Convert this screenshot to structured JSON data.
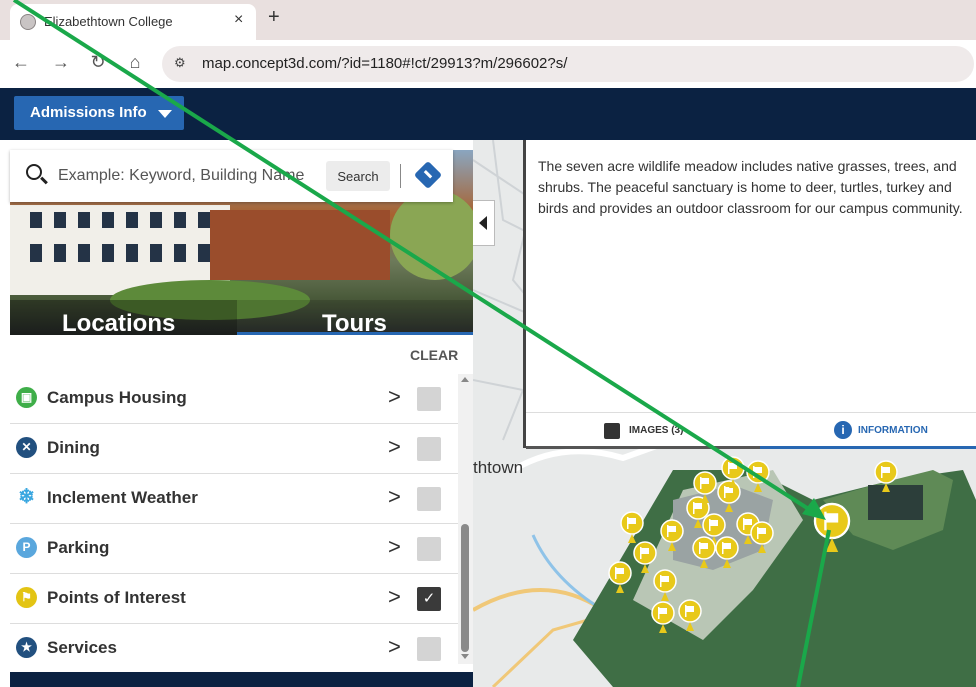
{
  "browser": {
    "tab_title": "Elizabethtown College",
    "close_glyph": "×",
    "newtab_glyph": "+",
    "url": "map.concept3d.com/?id=1180#!ct/29913?m/296602?s/",
    "back_glyph": "←",
    "forward_glyph": "→",
    "reload_glyph": "↻",
    "home_glyph": "⌂",
    "site_info_glyph": "⚙"
  },
  "header": {
    "admissions_label": "Admissions Info"
  },
  "search": {
    "placeholder": "Example: Keyword, Building Name",
    "button_label": "Search"
  },
  "hero": {
    "locations_label": "Locations",
    "tours_label": "Tours"
  },
  "filters": {
    "clear_label": "CLEAR",
    "categories": [
      {
        "label": "Campus Housing",
        "icon": "housing-icon",
        "color": "#3fae49",
        "glyph": "▣",
        "checked": false
      },
      {
        "label": "Dining",
        "icon": "dining-icon",
        "color": "#22507f",
        "glyph": "✕",
        "checked": false
      },
      {
        "label": "Inclement Weather",
        "icon": "snowflake-icon",
        "color": "#3aa7e0",
        "glyph": "❄",
        "checked": false
      },
      {
        "label": "Parking",
        "icon": "parking-icon",
        "color": "#5aa7dd",
        "glyph": "P",
        "checked": false
      },
      {
        "label": "Points of Interest",
        "icon": "flag-icon",
        "color": "#e3c414",
        "glyph": "⚑",
        "checked": true
      },
      {
        "label": "Services",
        "icon": "star-icon",
        "color": "#22507f",
        "glyph": "★",
        "checked": false
      }
    ],
    "chevron_glyph": ">",
    "check_glyph": "✓"
  },
  "info_panel": {
    "description": "The seven acre wildlife meadow includes native grasses, trees, and shrubs. The peaceful sanctuary is home to deer, turtles, turkey and birds and provides an outdoor classroom for our campus community.",
    "images_tab": "IMAGES (3)",
    "information_tab": "INFORMATION",
    "info_glyph": "i"
  },
  "map": {
    "place_label": "thtown",
    "marker_color": "#e8c91a",
    "overlay_color": "#1aa84a"
  }
}
